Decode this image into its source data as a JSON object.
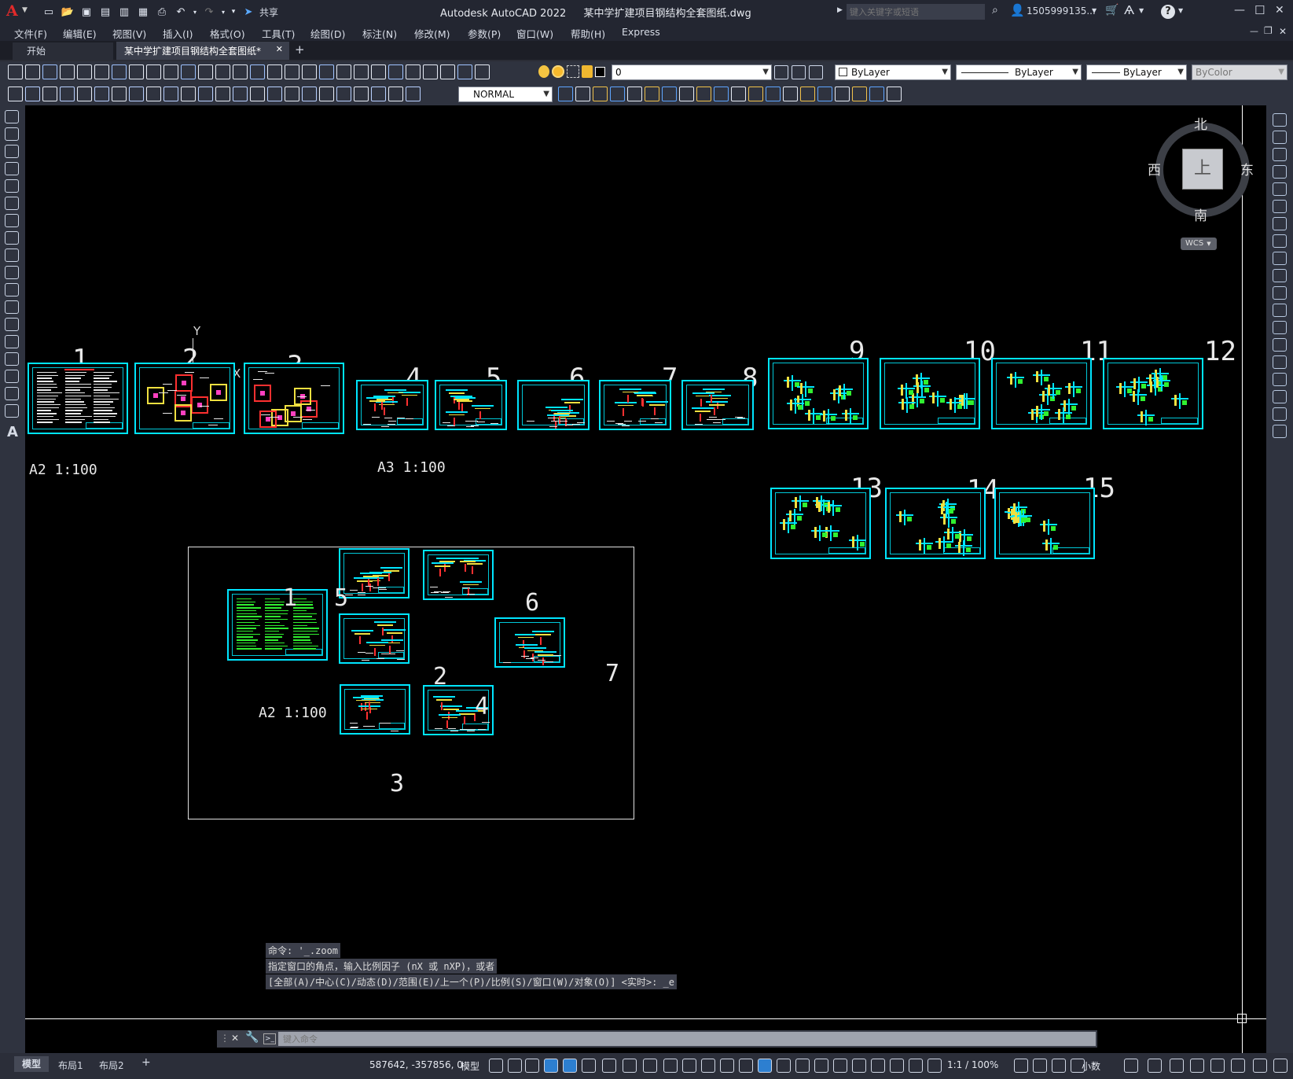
{
  "app": {
    "title": "Autodesk AutoCAD 2022",
    "document": "某中学扩建项目钢结构全套图纸.dwg",
    "logo": "A",
    "share_label": "共享",
    "search_placeholder": "键入关键字或短语",
    "user": "1505999135...",
    "window_buttons": [
      "—",
      "☐",
      "✕"
    ]
  },
  "menu": [
    "文件(F)",
    "编辑(E)",
    "视图(V)",
    "插入(I)",
    "格式(O)",
    "工具(T)",
    "绘图(D)",
    "标注(N)",
    "修改(M)",
    "参数(P)",
    "窗口(W)",
    "帮助(H)",
    "Express"
  ],
  "tabs": {
    "start": "开始",
    "active": "某中学扩建项目钢结构全套图纸*",
    "close": "✕",
    "add": "+"
  },
  "toolbar": {
    "layer_value": "0",
    "color_value": "ByLayer",
    "linetype_value": "ByLayer",
    "lineweight_value": "ByLayer",
    "plotstyle_value": "ByColor",
    "dimstyle_value": "NORMAL"
  },
  "viewcube": {
    "north": "北",
    "south": "南",
    "east": "东",
    "west": "西",
    "top": "上",
    "wcs": "WCS"
  },
  "ucs": {
    "y": "Y",
    "x": "X"
  },
  "drawing": {
    "top_numbers": [
      "1",
      "2",
      "3",
      "4",
      "5",
      "6",
      "7",
      "8",
      "9",
      "10",
      "11",
      "12",
      "13",
      "14",
      "15"
    ],
    "scale_a2": "A2 1:100",
    "scale_a3": "A3 1:100",
    "inset_numbers": [
      "1",
      "5",
      "6",
      "2",
      "7",
      "4",
      "3"
    ],
    "inset_scale": "A2 1:100"
  },
  "command": {
    "history": [
      "命令: '_.zoom",
      "指定窗口的角点，输入比例因子 (nX 或 nXP)，或者",
      "[全部(A)/中心(C)/动态(D)/范围(E)/上一个(P)/比例(S)/窗口(W)/对象(O)] <实时>: _e"
    ],
    "placeholder": "键入命令"
  },
  "layout_tabs": [
    "模型",
    "布局1",
    "布局2",
    "+"
  ],
  "status": {
    "coords": "587642, -357856, 0",
    "model": "模型",
    "scale": "1:1 / 100%",
    "units": "小数"
  }
}
